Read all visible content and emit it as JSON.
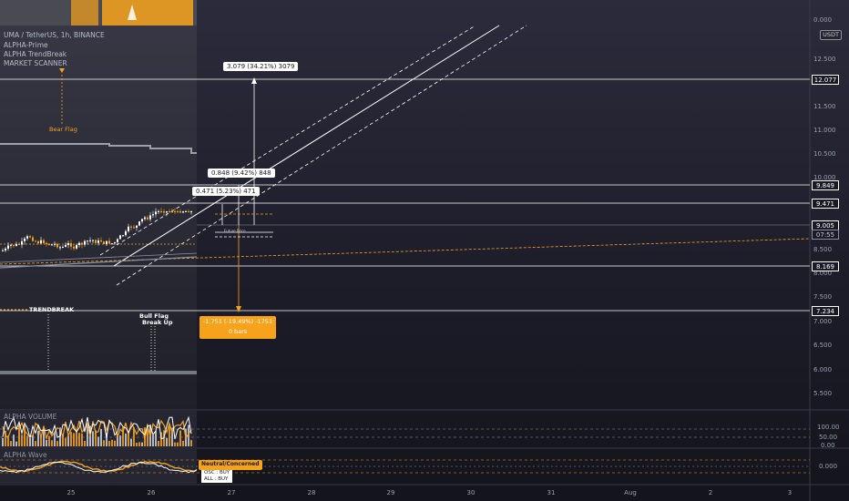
{
  "symbol_line": "UMA / TetherUS, 1h, BINANCE",
  "indicators": [
    "ALPHA-Prime",
    "ALPHA TrendBreak",
    "MARKET SCANNER"
  ],
  "currency_button": "USDT",
  "price_axis": {
    "ticks": [
      "0.000",
      "12.500",
      "11.500",
      "11.000",
      "10.500",
      "10.000",
      "8.500",
      "8.000",
      "7.500",
      "7.000",
      "6.500",
      "6.000",
      "5.500"
    ],
    "labels": [
      {
        "value": "12.077",
        "style": "outline"
      },
      {
        "value": "9.849",
        "style": "outline"
      },
      {
        "value": "9.471",
        "style": "outline"
      },
      {
        "value": "9.005",
        "style": "outline"
      },
      {
        "value": "07:55",
        "style": "outline"
      },
      {
        "value": "8.169",
        "style": "outline"
      },
      {
        "value": "7.234",
        "style": "outline"
      }
    ]
  },
  "measurements": [
    {
      "text": "3.079 (34.21%) 3079"
    },
    {
      "text": "0.848 (9.42%) 848"
    },
    {
      "text": "0.471 (5.23%) 471"
    },
    {
      "text": "-1.751 (-19.49%) -1751",
      "sub": "0 bars"
    }
  ],
  "annotations": {
    "bear_flag": "Bear Flag",
    "trendbreak": "TRENDBREAK",
    "bull_flag": "Bull Flag",
    "break_up": "Break Up",
    "future_price": "Future Price"
  },
  "volume_pane": {
    "title": "ALPHA VOLUME",
    "ticks": [
      "100.00",
      "50.00",
      "0.00"
    ]
  },
  "wave_pane": {
    "title": "ALPHA Wave",
    "tick": "0.000",
    "status_badge": "Neutral/Concerned",
    "osc": "OSC : BUY",
    "all": "ALL : BUY"
  },
  "time_axis": [
    "25",
    "26",
    "27",
    "28",
    "29",
    "30",
    "31",
    "Aug",
    "2",
    "3"
  ],
  "colors": {
    "background": "#1a1a26",
    "orange": "#f7a21b",
    "white": "#ffffff",
    "grid": "#2a2a38"
  },
  "icons": {
    "channel": "parallel-channel-tool",
    "measure": "price-range-tool"
  }
}
